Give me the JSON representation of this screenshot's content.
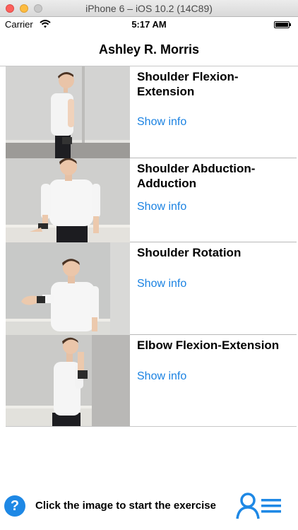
{
  "window": {
    "title": "iPhone 6 – iOS 10.2 (14C89)"
  },
  "status_bar": {
    "carrier": "Carrier",
    "time": "5:17 AM"
  },
  "nav": {
    "title": "Ashley R. Morris"
  },
  "exercises": [
    {
      "title": "Shoulder Flexion-Extension",
      "action": "Show info"
    },
    {
      "title": "Shoulder Abduction-Adduction",
      "action": "Show info"
    },
    {
      "title": "Shoulder Rotation",
      "action": "Show info"
    },
    {
      "title": "Elbow Flexion-Extension",
      "action": "Show info"
    }
  ],
  "footer": {
    "help_glyph": "?",
    "instruction": "Click the image to start the exercise"
  },
  "colors": {
    "accent": "#1a82e2",
    "help_bg": "#1e88e5",
    "icon": "#1e88e5"
  }
}
